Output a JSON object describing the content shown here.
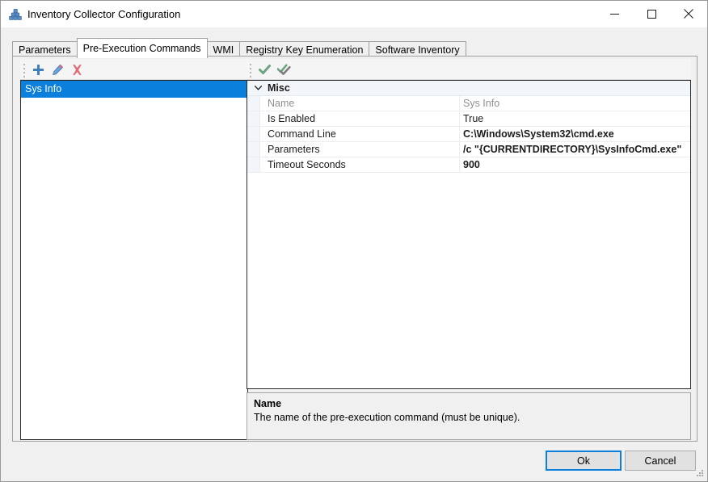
{
  "window": {
    "title": "Inventory Collector Configuration",
    "icon": "stacked-cubes-icon",
    "controls": {
      "minimize": "minimize-icon",
      "maximize": "maximize-icon",
      "close": "close-icon"
    }
  },
  "tabs": [
    {
      "label": "Parameters",
      "active": false
    },
    {
      "label": "Pre-Execution Commands",
      "active": true
    },
    {
      "label": "WMI",
      "active": false
    },
    {
      "label": "Registry Key Enumeration",
      "active": false
    },
    {
      "label": "Software Inventory",
      "active": false
    }
  ],
  "left_panel": {
    "toolbar": [
      {
        "name": "add-button",
        "icon": "plus-icon",
        "color": "#3f7fbf"
      },
      {
        "name": "edit-button",
        "icon": "pencil-icon",
        "color": "#4a8fd0"
      },
      {
        "name": "delete-button",
        "icon": "red-x-icon",
        "color": "#e06c75"
      }
    ],
    "items": [
      {
        "label": "Sys Info",
        "selected": true
      }
    ]
  },
  "right_panel": {
    "toolbar": [
      {
        "name": "check-button",
        "icon": "check-icon",
        "color": "#6aa57f"
      },
      {
        "name": "double-check-button",
        "icon": "double-check-icon",
        "color": "#6aa57f"
      }
    ],
    "property_grid": {
      "category": "Misc",
      "expanded": true,
      "rows": [
        {
          "name": "Name",
          "value": "Sys Info",
          "name_dim": true,
          "value_dim": true,
          "value_bold": false
        },
        {
          "name": "Is Enabled",
          "value": "True",
          "name_dim": false,
          "value_dim": false,
          "value_bold": false
        },
        {
          "name": "Command Line",
          "value": "C:\\Windows\\System32\\cmd.exe",
          "name_dim": false,
          "value_dim": false,
          "value_bold": true
        },
        {
          "name": "Parameters",
          "value": "/c \"{CURRENTDIRECTORY}\\SysInfoCmd.exe\"",
          "name_dim": false,
          "value_dim": false,
          "value_bold": true
        },
        {
          "name": "Timeout Seconds",
          "value": "900",
          "name_dim": false,
          "value_dim": false,
          "value_bold": true
        }
      ]
    },
    "description": {
      "title": "Name",
      "text": "The name of the pre-execution command (must be unique)."
    }
  },
  "footer": {
    "ok_label": "Ok",
    "cancel_label": "Cancel"
  },
  "colors": {
    "selection": "#0a7fdb",
    "focus_border": "#0a7fdb",
    "window_bg": "#f0f0f0",
    "panel_bg": "#ffffff"
  }
}
